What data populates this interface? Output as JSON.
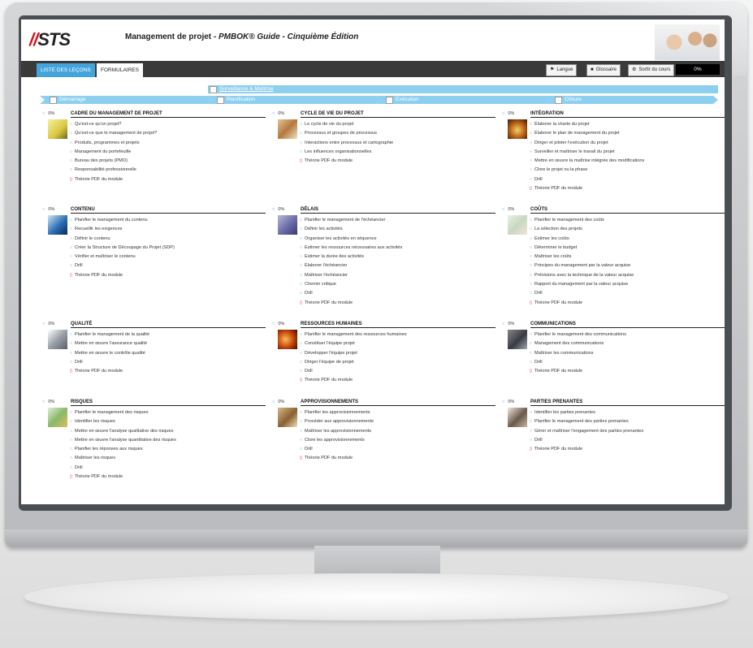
{
  "header": {
    "logo_text": "STS",
    "title_prefix": "Management de projet - ",
    "title_em": "PMBOK® Guide - Cinquième Édition"
  },
  "nav": {
    "tabs": [
      "LISTE DES LEÇONS",
      "FORMULAIRES"
    ],
    "buttons": {
      "langue": "Langue",
      "glossaire": "Glossaire",
      "sortir": "Sortir du cours"
    },
    "progress": "0%"
  },
  "process_groups": {
    "surveillance": "Surveillance & Maîtrise",
    "demarrage": "Démarrage",
    "planification": "Planification",
    "execution": "Exécution",
    "cloture": "Clôture"
  },
  "modules": [
    {
      "pct": "0%",
      "title": "CADRE DU MANAGEMENT DE PROJET",
      "items": [
        "Qu'est-ce qu'un projet?",
        "Qu'est-ce que le management de projet?",
        "Produits, programmes et projets",
        "Management du portefeuille",
        "Bureau des projets (PMO)",
        "Responsabilité professionnelle"
      ],
      "pdf": "Théorie PDF du module"
    },
    {
      "pct": "0%",
      "title": "CYCLE DE VIE DU PROJET",
      "items": [
        "Le cycle de vie du projet",
        "Processus et groupes de processus",
        "Interactions entre processus et cartographie",
        "Les influences organisationnelles"
      ],
      "pdf": "Théorie PDF du module"
    },
    {
      "pct": "0%",
      "title": "INTÉGRATION",
      "items": [
        "Élaborer la charte du projet",
        "Élaborer le plan de management du projet",
        "Diriger et piloter l'exécution du projet",
        "Surveiller et maîtriser le travail du projet",
        "Mettre en œuvre la maîtrise intégrée des modifications",
        "Clore le projet ou la phase",
        "Drill"
      ],
      "pdf": "Théorie PDF du module"
    },
    {
      "pct": "0%",
      "title": "CONTENU",
      "items": [
        "Planifier le management du contenu",
        "Recueillir les exigences",
        "Définir le contenu",
        "Créer la Structure de Découpage du Projet (SDP)",
        "Vérifier et maîtriser le contenu",
        "Drill"
      ],
      "pdf": "Théorie PDF du module"
    },
    {
      "pct": "0%",
      "title": "DÉLAIS",
      "items": [
        "Planifier le management de l'échéancier",
        "Définir les activités",
        "Organiser les activités en séquence",
        "Estimer les ressources nécessaires aux activités",
        "Estimer la durée des activités",
        "Élaborer l'échéancier",
        "Maîtriser l'échéancier",
        "Chemin critique",
        "Drill"
      ],
      "pdf": "Théorie PDF du module"
    },
    {
      "pct": "0%",
      "title": "COÛTS",
      "items": [
        "Planifier le management des coûts",
        "La sélection des projets",
        "Estimer les coûts",
        "Déterminer le budget",
        "Maîtriser les coûts",
        "Principes du management par la valeur acquise",
        "Prévisions avec la technique de la valeur acquise",
        "Rapport du management par la valeur acquise",
        "Drill"
      ],
      "pdf": "Théorie PDF du module"
    },
    {
      "pct": "0%",
      "title": "QUALITÉ",
      "items": [
        "Planifier le management de la qualité",
        "Mettre en œuvre l'assurance qualité",
        "Mettre en œuvre le contrôle qualité",
        "Drill"
      ],
      "pdf": "Théorie PDF du module"
    },
    {
      "pct": "0%",
      "title": "RESSOURCES HUMAINES",
      "items": [
        "Planifier le management des ressources humaines",
        "Constituer l'équipe projet",
        "Développer l'équipe projet",
        "Diriger l'équipe de projet",
        "Drill"
      ],
      "pdf": "Théorie PDF du module"
    },
    {
      "pct": "0%",
      "title": "COMMUNICATIONS",
      "items": [
        "Planifier le management des communications",
        "Management des communications",
        "Maîtriser les communications",
        "Drill"
      ],
      "pdf": "Théorie PDF du module"
    },
    {
      "pct": "0%",
      "title": "RISQUES",
      "items": [
        "Planifier le management des risques",
        "Identifier les risques",
        "Mettre en œuvre l'analyse qualitative des risques",
        "Mettre en œuvre l'analyse quantitative des risques",
        "Planifier les réponses aux risques",
        "Maîtriser les risques",
        "Drill"
      ],
      "pdf": "Théorie PDF du module"
    },
    {
      "pct": "0%",
      "title": "APPROVISIONNEMENTS",
      "items": [
        "Planifier les approvisionnements",
        "Procéder aux approvisionnements",
        "Maîtriser les approvisionnements",
        "Clore les approvisionnements",
        "Drill"
      ],
      "pdf": "Théorie PDF du module"
    },
    {
      "pct": "0%",
      "title": "PARTIES PRENANTES",
      "items": [
        "Identifier les parties prenantes",
        "Planifier le management des parties prenantes",
        "Gérer et maîtriser l'engagement des parties prenantes",
        "Drill"
      ],
      "pdf": "Théorie PDF du module"
    }
  ],
  "colors": {
    "accent": "#45a3dc",
    "bar": "#8ccfef",
    "dark": "#3a3a3a",
    "pdf": "#d0141e"
  }
}
